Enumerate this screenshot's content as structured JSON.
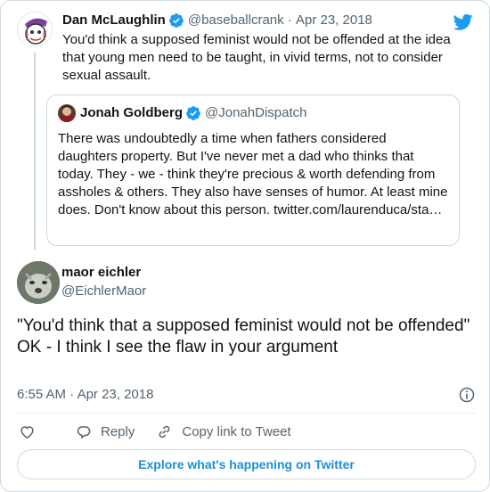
{
  "parent_tweet": {
    "author_name": "Dan McLaughlin",
    "handle": "@baseballcrank",
    "date": "Apr 23, 2018",
    "text": "You'd think a supposed feminist would not be offended at the idea that young men need to be taught, in vivid terms, not to consider sexual assault."
  },
  "quoted_tweet": {
    "author_name": "Jonah Goldberg",
    "handle": "@JonahDispatch",
    "text": "There was undoubtedly a time when fathers considered daughters property. But I've never met a dad who thinks that today. They - we - think they're precious & worth defending from assholes & others. They also have senses of humor. At least mine does. Don't know about this person. twitter.com/laurenduca/sta…"
  },
  "main_tweet": {
    "author_name": "maor eichler",
    "handle": "@EichlerMaor",
    "line1": "\"You'd think that a supposed feminist would not be offended\"",
    "line2": "OK - I think I see the flaw in your argument",
    "time": "6:55 AM",
    "date": "Apr 23, 2018"
  },
  "actions": {
    "reply": "Reply",
    "copy_link": "Copy link to Tweet"
  },
  "explore_label": "Explore what's happening on Twitter",
  "colors": {
    "twitter_blue": "#1d9bf0",
    "link_blue": "#1d8fd8",
    "muted": "#536471",
    "border": "#cfd9de"
  },
  "icons": [
    "twitter-logo-icon",
    "verified-badge-icon",
    "info-icon",
    "heart-icon",
    "reply-icon",
    "link-icon"
  ]
}
